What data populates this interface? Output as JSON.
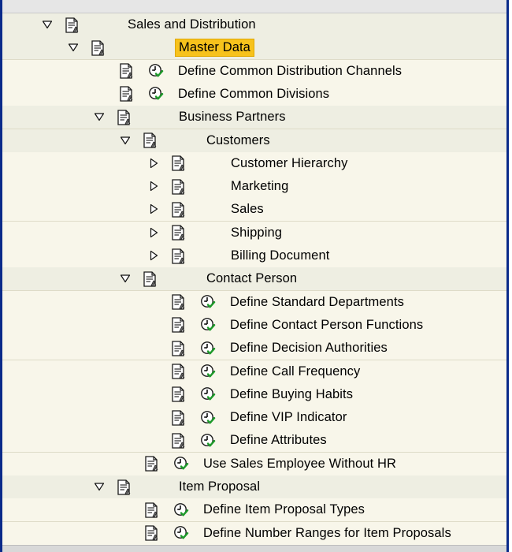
{
  "tree": [
    {
      "label": "Sales and Distribution",
      "level": 0,
      "node": "branch",
      "state": "expanded",
      "clock": false,
      "highlight": false
    },
    {
      "label": "Master Data",
      "level": 1,
      "node": "branch",
      "state": "expanded",
      "clock": false,
      "highlight": true
    },
    {
      "label": "Define Common Distribution Channels",
      "level": 2,
      "node": "activity",
      "state": "",
      "clock": true,
      "highlight": false
    },
    {
      "label": "Define Common Divisions",
      "level": 2,
      "node": "activity",
      "state": "",
      "clock": true,
      "highlight": false
    },
    {
      "label": "Business Partners",
      "level": 2,
      "node": "branch",
      "state": "expanded",
      "clock": false,
      "highlight": false
    },
    {
      "label": "Customers",
      "level": 3,
      "node": "branch",
      "state": "expanded",
      "clock": false,
      "highlight": false
    },
    {
      "label": "Customer Hierarchy",
      "level": 4,
      "node": "branch",
      "state": "collapsed",
      "clock": false,
      "highlight": false
    },
    {
      "label": "Marketing",
      "level": 4,
      "node": "branch",
      "state": "collapsed",
      "clock": false,
      "highlight": false
    },
    {
      "label": "Sales",
      "level": 4,
      "node": "branch",
      "state": "collapsed",
      "clock": false,
      "highlight": false
    },
    {
      "label": "Shipping",
      "level": 4,
      "node": "branch",
      "state": "collapsed",
      "clock": false,
      "highlight": false
    },
    {
      "label": "Billing Document",
      "level": 4,
      "node": "branch",
      "state": "collapsed",
      "clock": false,
      "highlight": false
    },
    {
      "label": "Contact Person",
      "level": 3,
      "node": "branch",
      "state": "expanded",
      "clock": false,
      "highlight": false
    },
    {
      "label": "Define Standard Departments",
      "level": 4,
      "node": "activity",
      "state": "",
      "clock": true,
      "highlight": false
    },
    {
      "label": "Define Contact Person Functions",
      "level": 4,
      "node": "activity",
      "state": "",
      "clock": true,
      "highlight": false
    },
    {
      "label": "Define Decision Authorities",
      "level": 4,
      "node": "activity",
      "state": "",
      "clock": true,
      "highlight": false
    },
    {
      "label": "Define Call Frequency",
      "level": 4,
      "node": "activity",
      "state": "",
      "clock": true,
      "highlight": false
    },
    {
      "label": "Define Buying Habits",
      "level": 4,
      "node": "activity",
      "state": "",
      "clock": true,
      "highlight": false
    },
    {
      "label": "Define VIP Indicator",
      "level": 4,
      "node": "activity",
      "state": "",
      "clock": true,
      "highlight": false
    },
    {
      "label": "Define Attributes",
      "level": 4,
      "node": "activity",
      "state": "",
      "clock": true,
      "highlight": false
    },
    {
      "label": "Use Sales Employee Without HR",
      "level": 3,
      "node": "activity",
      "state": "",
      "clock": true,
      "highlight": false
    },
    {
      "label": "Item Proposal",
      "level": 2,
      "node": "branch",
      "state": "expanded",
      "clock": false,
      "highlight": false
    },
    {
      "label": "Define Item Proposal Types",
      "level": 3,
      "node": "activity",
      "state": "",
      "clock": true,
      "highlight": false
    },
    {
      "label": "Define Number Ranges for Item Proposals",
      "level": 3,
      "node": "activity",
      "state": "",
      "clock": true,
      "highlight": false
    }
  ],
  "icons": {
    "expanded": "triangle-down-icon",
    "collapsed": "triangle-right-icon",
    "document": "document-icon",
    "execute": "execute-clock-icon"
  },
  "colors": {
    "highlight": "#f7c21c",
    "tree_background": "#f8f6ea",
    "border": "#0a2a8a",
    "check_green": "#1d9a2a"
  }
}
